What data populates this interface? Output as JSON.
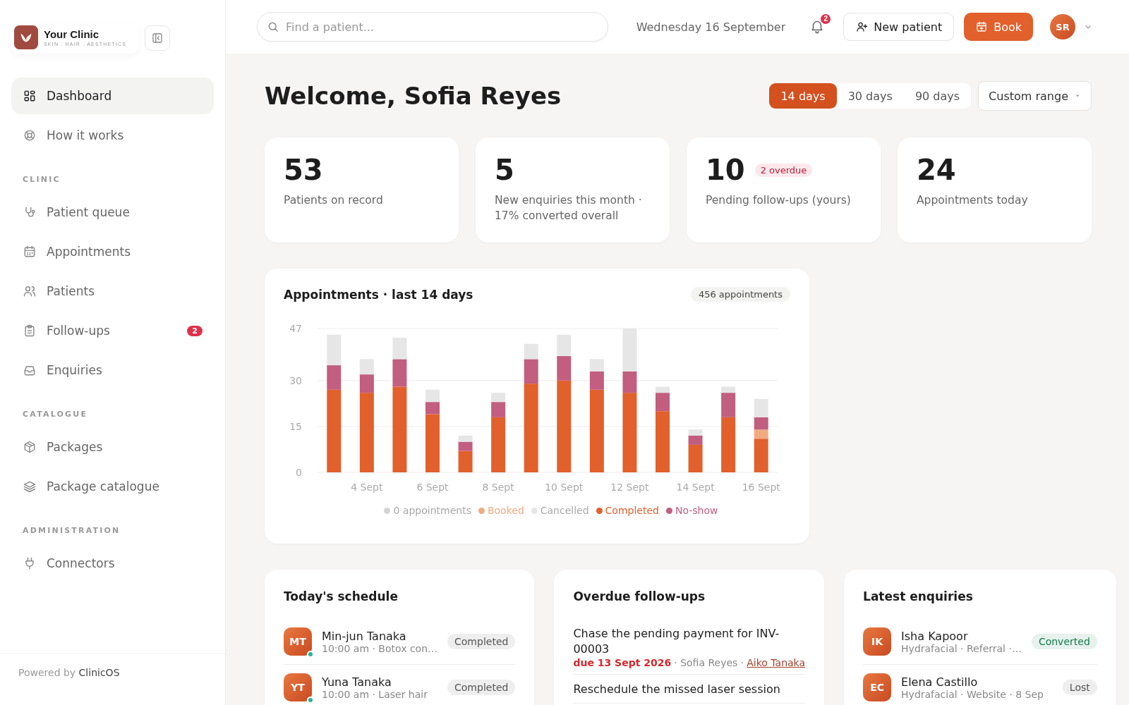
{
  "brand": {
    "name": "Your Clinic",
    "tagline": "SKIN . HAIR . AESTHETICS"
  },
  "sidebar": {
    "sections": [
      {
        "items": [
          {
            "label": "Dashboard",
            "selected": true
          },
          {
            "label": "How it works",
            "selected": false
          }
        ]
      },
      {
        "heading": "CLINIC",
        "items": [
          {
            "label": "Patient queue",
            "selected": false
          },
          {
            "label": "Appointments",
            "selected": false
          },
          {
            "label": "Patients",
            "selected": false
          },
          {
            "label": "Follow-ups",
            "selected": false,
            "badge": "2"
          },
          {
            "label": "Enquiries",
            "selected": false
          }
        ]
      },
      {
        "heading": "CATALOGUE",
        "items": [
          {
            "label": "Packages",
            "selected": false
          },
          {
            "label": "Package catalogue",
            "selected": false
          }
        ]
      },
      {
        "heading": "ADMINISTRATION",
        "items": [
          {
            "label": "Connectors",
            "selected": false
          }
        ]
      }
    ],
    "footer": {
      "prefix": "Powered by",
      "product": "ClinicOS"
    }
  },
  "topbar": {
    "search": {
      "placeholder": "Find a patient..."
    },
    "date": "Wednesday 16 September",
    "notifications": "2",
    "new_patient": "New patient",
    "book": "Book",
    "user_initials": "SR"
  },
  "greeting": "Welcome, Sofia Reyes",
  "periods": [
    {
      "label": "14 days",
      "selected": true
    },
    {
      "label": "30 days",
      "selected": false
    },
    {
      "label": "90 days",
      "selected": false
    }
  ],
  "custom_range": "Custom range",
  "stats": [
    {
      "value": "53",
      "label": "Patients on record"
    },
    {
      "value": "5",
      "label": "New enquiries this month · 17% converted overall"
    },
    {
      "value": "10",
      "badge": "2 overdue",
      "label": "Pending follow-ups (yours)"
    },
    {
      "value": "24",
      "label": "Appointments today"
    }
  ],
  "chart_card": {
    "title": "Appointments · last 14 days",
    "total": "456 appointments",
    "chart_data": {
      "type": "bar",
      "stacked": true,
      "orientation": "vertical",
      "categories": [
        null,
        "4 Sept",
        null,
        "6 Sept",
        null,
        "8 Sept",
        null,
        "10 Sept",
        null,
        "12 Sept",
        null,
        "14 Sept",
        null,
        "16 Sept"
      ],
      "ylim": [
        0,
        47
      ],
      "yticks": [
        0,
        15,
        30,
        47
      ],
      "series": [
        {
          "name": "Completed",
          "color": "#e2602c",
          "values": [
            27,
            26,
            28,
            19,
            7,
            18,
            29,
            30,
            27,
            26,
            20,
            9,
            18,
            11
          ]
        },
        {
          "name": "Booked",
          "color": "#f2aa80",
          "values": [
            0,
            0,
            0,
            0,
            0,
            0,
            0,
            0,
            0,
            0,
            0,
            0,
            0,
            3
          ]
        },
        {
          "name": "No-show",
          "color": "#c25e80",
          "values": [
            8,
            6,
            9,
            4,
            3,
            5,
            8,
            8,
            6,
            7,
            6,
            3,
            8,
            4
          ]
        },
        {
          "name": "Cancelled",
          "color": "#e6e6e6",
          "values": [
            10,
            5,
            7,
            4,
            2,
            3,
            5,
            7,
            4,
            14,
            2,
            2,
            2,
            6
          ]
        },
        {
          "name": "0 appointments",
          "color": "#d4d4d4",
          "values": [
            0,
            0,
            0,
            0,
            0,
            0,
            0,
            0,
            0,
            0,
            0,
            0,
            0,
            0
          ]
        }
      ],
      "legend": "bottom"
    }
  },
  "schedule": {
    "title": "Today's schedule",
    "items": [
      {
        "initials": "MT",
        "name": "Min-jun Tanaka",
        "detail": "10:00 am · Botox con…",
        "status": "Completed",
        "color": "#555555",
        "checked_in": true
      },
      {
        "initials": "YT",
        "name": "Yuna Tanaka",
        "detail": "10:00 am · Laser hair",
        "status": "Completed",
        "color": "#555555",
        "checked_in": true
      }
    ]
  },
  "followups": {
    "title": "Overdue follow-ups",
    "items": [
      {
        "task": "Chase the pending payment for INV-00003",
        "due": "due 13 Sept 2026",
        "owner": "· Sofia Reyes ·",
        "patient": "Aiko Tanaka"
      },
      {
        "task": "Reschedule the missed laser session"
      }
    ]
  },
  "enquiries": {
    "title": "Latest enquiries",
    "items": [
      {
        "initials": "IK",
        "name": "Isha Kapoor",
        "detail": "Hydrafacial · Referral ·…",
        "status": "Converted",
        "color": "#137a4f"
      },
      {
        "initials": "EC",
        "name": "Elena Castillo",
        "detail": "Hydrafacial · Website · 8 Sep",
        "status": "Lost",
        "color": "#555555"
      }
    ]
  }
}
